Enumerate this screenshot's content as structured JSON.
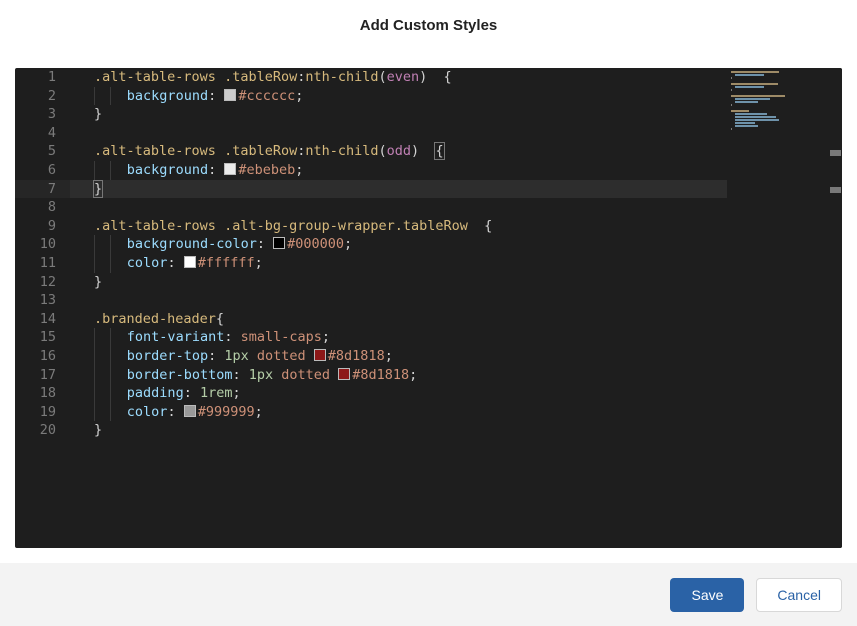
{
  "header": {
    "title": "Add Custom Styles"
  },
  "editor": {
    "lines": [
      {
        "n": 1,
        "indent": 0,
        "tokens": [
          {
            "k": "selector",
            "t": ".alt-table-rows"
          },
          {
            "k": "punct",
            "t": " "
          },
          {
            "k": "selector",
            "t": ".tableRow"
          },
          {
            "k": "punct",
            "t": ":"
          },
          {
            "k": "selector",
            "t": "nth-child"
          },
          {
            "k": "punct",
            "t": "("
          },
          {
            "k": "pseudo",
            "t": "even"
          },
          {
            "k": "punct",
            "t": ")  {"
          }
        ]
      },
      {
        "n": 2,
        "indent": 2,
        "tokens": [
          {
            "k": "prop",
            "t": "background"
          },
          {
            "k": "punct",
            "t": ": "
          },
          {
            "k": "swatch",
            "c": "#cccccc"
          },
          {
            "k": "val",
            "t": "#cccccc"
          },
          {
            "k": "punct",
            "t": ";"
          }
        ]
      },
      {
        "n": 3,
        "indent": 0,
        "tokens": [
          {
            "k": "punct",
            "t": "}"
          }
        ]
      },
      {
        "n": 4,
        "indent": 0,
        "tokens": []
      },
      {
        "n": 5,
        "indent": 0,
        "tokens": [
          {
            "k": "selector",
            "t": ".alt-table-rows"
          },
          {
            "k": "punct",
            "t": " "
          },
          {
            "k": "selector",
            "t": ".tableRow"
          },
          {
            "k": "punct",
            "t": ":"
          },
          {
            "k": "selector",
            "t": "nth-child"
          },
          {
            "k": "punct",
            "t": "("
          },
          {
            "k": "pseudo",
            "t": "odd"
          },
          {
            "k": "punct",
            "t": ")  "
          },
          {
            "k": "punct",
            "t": "{",
            "match": true
          }
        ]
      },
      {
        "n": 6,
        "indent": 2,
        "tokens": [
          {
            "k": "prop",
            "t": "background"
          },
          {
            "k": "punct",
            "t": ": "
          },
          {
            "k": "swatch",
            "c": "#ebebeb"
          },
          {
            "k": "val",
            "t": "#ebebeb"
          },
          {
            "k": "punct",
            "t": ";"
          }
        ]
      },
      {
        "n": 7,
        "indent": 0,
        "hl": true,
        "tokens": [
          {
            "k": "punct",
            "t": "}",
            "match": true
          }
        ]
      },
      {
        "n": 8,
        "indent": 0,
        "tokens": []
      },
      {
        "n": 9,
        "indent": 0,
        "tokens": [
          {
            "k": "selector",
            "t": ".alt-table-rows"
          },
          {
            "k": "punct",
            "t": " "
          },
          {
            "k": "selector",
            "t": ".alt-bg-group-wrapper.tableRow"
          },
          {
            "k": "punct",
            "t": "  {"
          }
        ]
      },
      {
        "n": 10,
        "indent": 2,
        "tokens": [
          {
            "k": "prop",
            "t": "background-color"
          },
          {
            "k": "punct",
            "t": ": "
          },
          {
            "k": "swatch",
            "c": "#000000"
          },
          {
            "k": "val",
            "t": "#000000"
          },
          {
            "k": "punct",
            "t": ";"
          }
        ]
      },
      {
        "n": 11,
        "indent": 2,
        "tokens": [
          {
            "k": "prop",
            "t": "color"
          },
          {
            "k": "punct",
            "t": ": "
          },
          {
            "k": "swatch",
            "c": "#ffffff"
          },
          {
            "k": "val",
            "t": "#ffffff"
          },
          {
            "k": "punct",
            "t": ";"
          }
        ]
      },
      {
        "n": 12,
        "indent": 0,
        "tokens": [
          {
            "k": "punct",
            "t": "}"
          }
        ]
      },
      {
        "n": 13,
        "indent": 0,
        "tokens": []
      },
      {
        "n": 14,
        "indent": 0,
        "tokens": [
          {
            "k": "selector",
            "t": ".branded-header"
          },
          {
            "k": "punct",
            "t": "{"
          }
        ]
      },
      {
        "n": 15,
        "indent": 2,
        "tokens": [
          {
            "k": "prop",
            "t": "font-variant"
          },
          {
            "k": "punct",
            "t": ": "
          },
          {
            "k": "val",
            "t": "small-caps"
          },
          {
            "k": "punct",
            "t": ";"
          }
        ]
      },
      {
        "n": 16,
        "indent": 2,
        "tokens": [
          {
            "k": "prop",
            "t": "border-top"
          },
          {
            "k": "punct",
            "t": ": "
          },
          {
            "k": "num",
            "t": "1px"
          },
          {
            "k": "punct",
            "t": " "
          },
          {
            "k": "val",
            "t": "dotted"
          },
          {
            "k": "punct",
            "t": " "
          },
          {
            "k": "swatch",
            "c": "#8d1818"
          },
          {
            "k": "val",
            "t": "#8d1818"
          },
          {
            "k": "punct",
            "t": ";"
          }
        ]
      },
      {
        "n": 17,
        "indent": 2,
        "tokens": [
          {
            "k": "prop",
            "t": "border-bottom"
          },
          {
            "k": "punct",
            "t": ": "
          },
          {
            "k": "num",
            "t": "1px"
          },
          {
            "k": "punct",
            "t": " "
          },
          {
            "k": "val",
            "t": "dotted"
          },
          {
            "k": "punct",
            "t": " "
          },
          {
            "k": "swatch",
            "c": "#8d1818"
          },
          {
            "k": "val",
            "t": "#8d1818"
          },
          {
            "k": "punct",
            "t": ";"
          }
        ]
      },
      {
        "n": 18,
        "indent": 2,
        "tokens": [
          {
            "k": "prop",
            "t": "padding"
          },
          {
            "k": "punct",
            "t": ": "
          },
          {
            "k": "num",
            "t": "1rem"
          },
          {
            "k": "punct",
            "t": ";"
          }
        ]
      },
      {
        "n": 19,
        "indent": 2,
        "tokens": [
          {
            "k": "prop",
            "t": "color"
          },
          {
            "k": "punct",
            "t": ": "
          },
          {
            "k": "swatch",
            "c": "#999999"
          },
          {
            "k": "val",
            "t": "#999999"
          },
          {
            "k": "punct",
            "t": ";"
          }
        ]
      },
      {
        "n": 20,
        "indent": 0,
        "tokens": [
          {
            "k": "punct",
            "t": "}"
          }
        ]
      }
    ]
  },
  "footer": {
    "save_label": "Save",
    "cancel_label": "Cancel"
  }
}
